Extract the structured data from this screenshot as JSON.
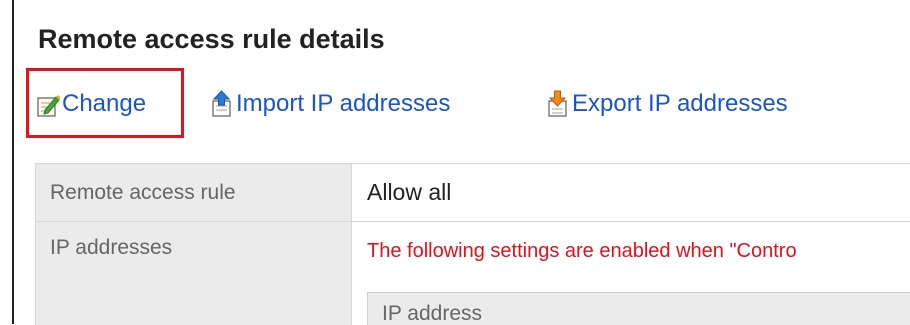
{
  "page_title": "Remote access rule details",
  "toolbar": {
    "change_label": "Change",
    "import_label": "Import IP addresses",
    "export_label": "Export IP addresses"
  },
  "details": {
    "rule_label": "Remote access rule",
    "rule_value": "Allow all",
    "ip_label": "IP addresses",
    "ip_warning": "The following settings are enabled when \"Contro",
    "ip_table_header": "IP address"
  },
  "colors": {
    "link": "#1a55c9",
    "warning": "#e3101c",
    "highlight": "#e0141e",
    "label_bg": "#ebebeb"
  },
  "icons": {
    "change": "edit-pencil-icon",
    "import": "import-upload-icon",
    "export": "export-download-icon"
  }
}
